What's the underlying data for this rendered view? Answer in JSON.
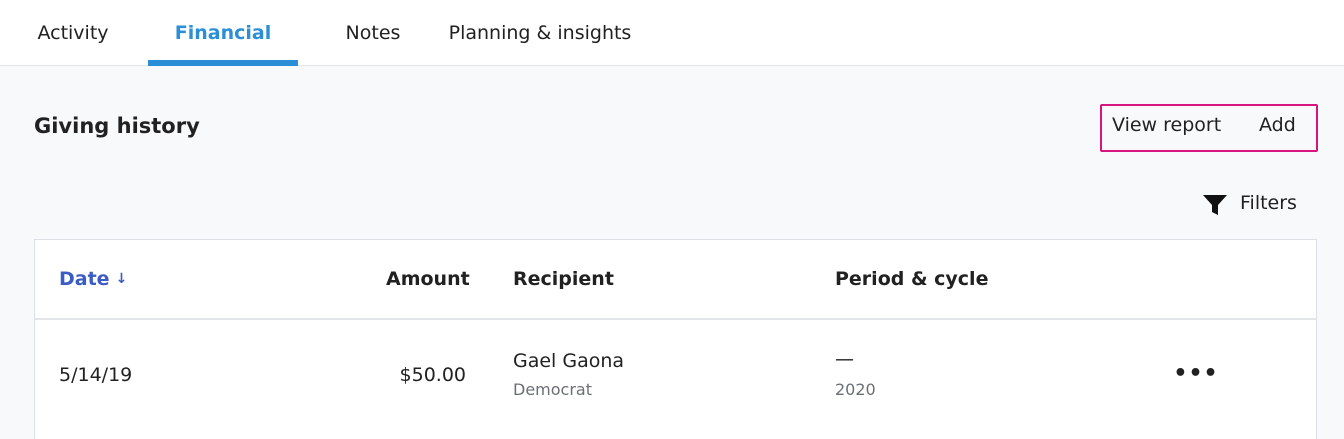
{
  "tabs": [
    {
      "label": "Activity",
      "active": false
    },
    {
      "label": "Financial",
      "active": true
    },
    {
      "label": "Notes",
      "active": false
    },
    {
      "label": "Planning & insights",
      "active": false
    }
  ],
  "section": {
    "title": "Giving history",
    "view_report_label": "View report",
    "add_label": "Add",
    "filters_label": "Filters"
  },
  "table": {
    "columns": {
      "date": "Date",
      "date_sort_arrow": "↓",
      "amount": "Amount",
      "recipient": "Recipient",
      "period": "Period & cycle"
    },
    "rows": [
      {
        "date": "5/14/19",
        "amount": "$50.00",
        "recipient_name": "Gael Gaona",
        "recipient_party": "Democrat",
        "period": "—",
        "cycle": "2020",
        "more": "•••"
      }
    ]
  },
  "colors": {
    "accent": "#2a8fd6",
    "sort_link": "#3b5cc4",
    "highlight_border": "#d6157e"
  },
  "icons": {
    "filter": "filter-funnel-icon",
    "sort": "arrow-down-icon",
    "more": "more-horizontal-icon"
  }
}
